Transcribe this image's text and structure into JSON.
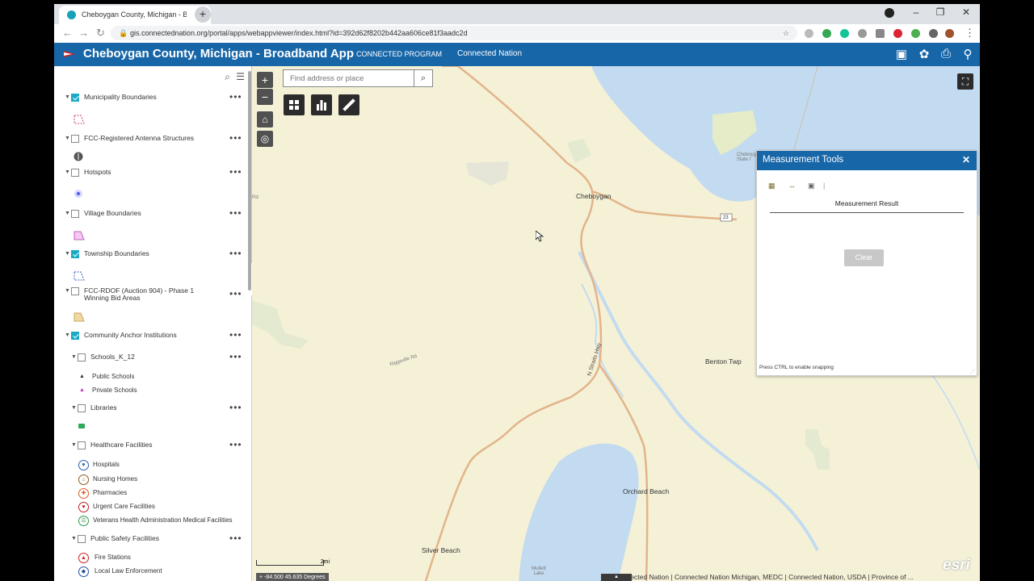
{
  "browser": {
    "tab_title": "Cheboygan County, Michigan - B",
    "url": "gis.connectednation.org/portal/apps/webappviewer/index.html?id=392d62f8202b442aa606ce81f3aadc2d"
  },
  "header": {
    "title": "Cheboygan County, Michigan - Broadband App",
    "links": [
      "CONNECTED PROGRAM",
      "Connected Nation"
    ]
  },
  "layers": [
    {
      "label": "Municipality Boundaries",
      "checked": true
    },
    {
      "label": "FCC-Registered Antenna Structures",
      "checked": false
    },
    {
      "label": "Hotspots",
      "checked": false
    },
    {
      "label": "Village Boundaries",
      "checked": false
    },
    {
      "label": "Township Boundaries",
      "checked": true
    },
    {
      "label": "FCC-RDOF (Auction 904) - Phase 1 Winning Bid Areas",
      "checked": false
    },
    {
      "label": "Community Anchor Institutions",
      "checked": true
    },
    {
      "label": "Schools_K_12",
      "checked": false
    },
    {
      "label": "Libraries",
      "checked": false
    },
    {
      "label": "Healthcare Facilities",
      "checked": false
    },
    {
      "label": "Public Safety Facilities",
      "checked": false
    }
  ],
  "legend": {
    "schools": [
      "Public Schools",
      "Private Schools"
    ],
    "healthcare": [
      "Hospitals",
      "Nursing Homes",
      "Pharmacies",
      "Urgent Care Facilities",
      "Veterans Health Administration Medical Facilities"
    ],
    "safety": [
      "Fire Stations",
      "Local Law Enforcement"
    ]
  },
  "map": {
    "search_placeholder": "Find address or place",
    "places": {
      "cheboygan": "Cheboygan",
      "benton": "Benton Twp",
      "orchard": "Orchard Beach",
      "silver": "Silver Beach",
      "road_23": "23",
      "straits": "N Straits Hwy",
      "riggsville": "Riggsville Rd",
      "mullett": "Mullett Lake",
      "cheboygan_state": "Cheboygan State I",
      "rd_left": "Rd"
    },
    "scale_label": "2mi",
    "coords": "-84.500 45.635 Degrees",
    "attribution": "Connected Nation | Connected Nation Michigan, MEDC | Connected Nation, USDA | Province of ..."
  },
  "measurement": {
    "title": "Measurement Tools",
    "result_label": "Measurement Result",
    "clear_label": "Clear",
    "hint": "Press CTRL to enable snapping"
  },
  "colors": {
    "header_blue": "#1766a8",
    "water": "#c3dbf0",
    "land": "#f5f1d7",
    "road": "#e2b48a",
    "check": "#1ba9c4"
  }
}
